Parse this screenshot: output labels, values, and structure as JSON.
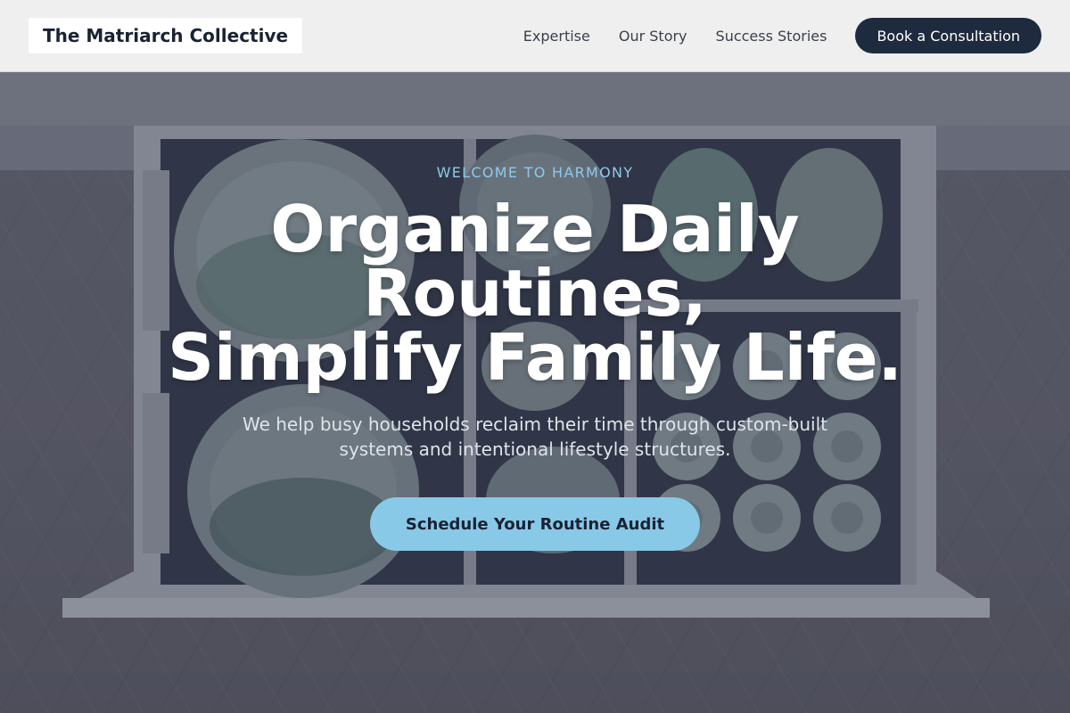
{
  "header": {
    "brand": "The Matriarch Collective",
    "nav": [
      {
        "label": "Expertise"
      },
      {
        "label": "Our Story"
      },
      {
        "label": "Success Stories"
      }
    ],
    "cta_label": "Book a Consultation"
  },
  "hero": {
    "eyebrow": "WELCOME TO HARMONY",
    "headline_line1": "Organize Daily",
    "headline_line2": "Routines,",
    "headline_line3": "Simplify Family Life.",
    "subtext": "We help busy households reclaim their time through custom-built systems and intentional lifestyle structures.",
    "button_label": "Schedule Your Routine Audit",
    "background_image": "drawer-of-ceramic-plates-and-cups-photo"
  },
  "colors": {
    "header_bg": "#efefef",
    "brand_text": "#1a2233",
    "nav_text": "#3a3f4b",
    "cta_bg": "#1e2a3e",
    "accent": "#88c9e8",
    "eyebrow": "#8ec9ea",
    "headline": "#ffffff",
    "subtext": "#dfe3ea"
  }
}
